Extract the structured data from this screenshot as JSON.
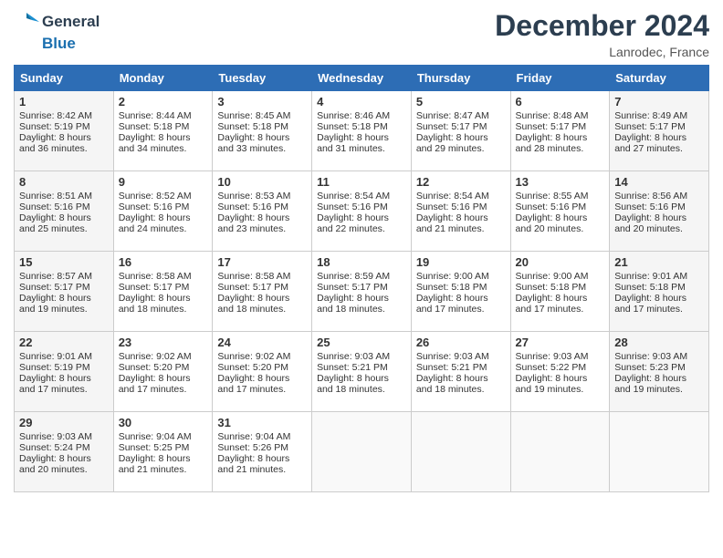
{
  "header": {
    "logo_line1": "General",
    "logo_line2": "Blue",
    "month": "December 2024",
    "location": "Lanrodec, France"
  },
  "days_of_week": [
    "Sunday",
    "Monday",
    "Tuesday",
    "Wednesday",
    "Thursday",
    "Friday",
    "Saturday"
  ],
  "weeks": [
    [
      {
        "day": "1",
        "rise": "Sunrise: 8:42 AM",
        "set": "Sunset: 5:19 PM",
        "daylight": "Daylight: 8 hours and 36 minutes."
      },
      {
        "day": "2",
        "rise": "Sunrise: 8:44 AM",
        "set": "Sunset: 5:18 PM",
        "daylight": "Daylight: 8 hours and 34 minutes."
      },
      {
        "day": "3",
        "rise": "Sunrise: 8:45 AM",
        "set": "Sunset: 5:18 PM",
        "daylight": "Daylight: 8 hours and 33 minutes."
      },
      {
        "day": "4",
        "rise": "Sunrise: 8:46 AM",
        "set": "Sunset: 5:18 PM",
        "daylight": "Daylight: 8 hours and 31 minutes."
      },
      {
        "day": "5",
        "rise": "Sunrise: 8:47 AM",
        "set": "Sunset: 5:17 PM",
        "daylight": "Daylight: 8 hours and 29 minutes."
      },
      {
        "day": "6",
        "rise": "Sunrise: 8:48 AM",
        "set": "Sunset: 5:17 PM",
        "daylight": "Daylight: 8 hours and 28 minutes."
      },
      {
        "day": "7",
        "rise": "Sunrise: 8:49 AM",
        "set": "Sunset: 5:17 PM",
        "daylight": "Daylight: 8 hours and 27 minutes."
      }
    ],
    [
      {
        "day": "8",
        "rise": "Sunrise: 8:51 AM",
        "set": "Sunset: 5:16 PM",
        "daylight": "Daylight: 8 hours and 25 minutes."
      },
      {
        "day": "9",
        "rise": "Sunrise: 8:52 AM",
        "set": "Sunset: 5:16 PM",
        "daylight": "Daylight: 8 hours and 24 minutes."
      },
      {
        "day": "10",
        "rise": "Sunrise: 8:53 AM",
        "set": "Sunset: 5:16 PM",
        "daylight": "Daylight: 8 hours and 23 minutes."
      },
      {
        "day": "11",
        "rise": "Sunrise: 8:54 AM",
        "set": "Sunset: 5:16 PM",
        "daylight": "Daylight: 8 hours and 22 minutes."
      },
      {
        "day": "12",
        "rise": "Sunrise: 8:54 AM",
        "set": "Sunset: 5:16 PM",
        "daylight": "Daylight: 8 hours and 21 minutes."
      },
      {
        "day": "13",
        "rise": "Sunrise: 8:55 AM",
        "set": "Sunset: 5:16 PM",
        "daylight": "Daylight: 8 hours and 20 minutes."
      },
      {
        "day": "14",
        "rise": "Sunrise: 8:56 AM",
        "set": "Sunset: 5:16 PM",
        "daylight": "Daylight: 8 hours and 20 minutes."
      }
    ],
    [
      {
        "day": "15",
        "rise": "Sunrise: 8:57 AM",
        "set": "Sunset: 5:17 PM",
        "daylight": "Daylight: 8 hours and 19 minutes."
      },
      {
        "day": "16",
        "rise": "Sunrise: 8:58 AM",
        "set": "Sunset: 5:17 PM",
        "daylight": "Daylight: 8 hours and 18 minutes."
      },
      {
        "day": "17",
        "rise": "Sunrise: 8:58 AM",
        "set": "Sunset: 5:17 PM",
        "daylight": "Daylight: 8 hours and 18 minutes."
      },
      {
        "day": "18",
        "rise": "Sunrise: 8:59 AM",
        "set": "Sunset: 5:17 PM",
        "daylight": "Daylight: 8 hours and 18 minutes."
      },
      {
        "day": "19",
        "rise": "Sunrise: 9:00 AM",
        "set": "Sunset: 5:18 PM",
        "daylight": "Daylight: 8 hours and 17 minutes."
      },
      {
        "day": "20",
        "rise": "Sunrise: 9:00 AM",
        "set": "Sunset: 5:18 PM",
        "daylight": "Daylight: 8 hours and 17 minutes."
      },
      {
        "day": "21",
        "rise": "Sunrise: 9:01 AM",
        "set": "Sunset: 5:18 PM",
        "daylight": "Daylight: 8 hours and 17 minutes."
      }
    ],
    [
      {
        "day": "22",
        "rise": "Sunrise: 9:01 AM",
        "set": "Sunset: 5:19 PM",
        "daylight": "Daylight: 8 hours and 17 minutes."
      },
      {
        "day": "23",
        "rise": "Sunrise: 9:02 AM",
        "set": "Sunset: 5:20 PM",
        "daylight": "Daylight: 8 hours and 17 minutes."
      },
      {
        "day": "24",
        "rise": "Sunrise: 9:02 AM",
        "set": "Sunset: 5:20 PM",
        "daylight": "Daylight: 8 hours and 17 minutes."
      },
      {
        "day": "25",
        "rise": "Sunrise: 9:03 AM",
        "set": "Sunset: 5:21 PM",
        "daylight": "Daylight: 8 hours and 18 minutes."
      },
      {
        "day": "26",
        "rise": "Sunrise: 9:03 AM",
        "set": "Sunset: 5:21 PM",
        "daylight": "Daylight: 8 hours and 18 minutes."
      },
      {
        "day": "27",
        "rise": "Sunrise: 9:03 AM",
        "set": "Sunset: 5:22 PM",
        "daylight": "Daylight: 8 hours and 19 minutes."
      },
      {
        "day": "28",
        "rise": "Sunrise: 9:03 AM",
        "set": "Sunset: 5:23 PM",
        "daylight": "Daylight: 8 hours and 19 minutes."
      }
    ],
    [
      {
        "day": "29",
        "rise": "Sunrise: 9:03 AM",
        "set": "Sunset: 5:24 PM",
        "daylight": "Daylight: 8 hours and 20 minutes."
      },
      {
        "day": "30",
        "rise": "Sunrise: 9:04 AM",
        "set": "Sunset: 5:25 PM",
        "daylight": "Daylight: 8 hours and 21 minutes."
      },
      {
        "day": "31",
        "rise": "Sunrise: 9:04 AM",
        "set": "Sunset: 5:26 PM",
        "daylight": "Daylight: 8 hours and 21 minutes."
      },
      null,
      null,
      null,
      null
    ]
  ]
}
